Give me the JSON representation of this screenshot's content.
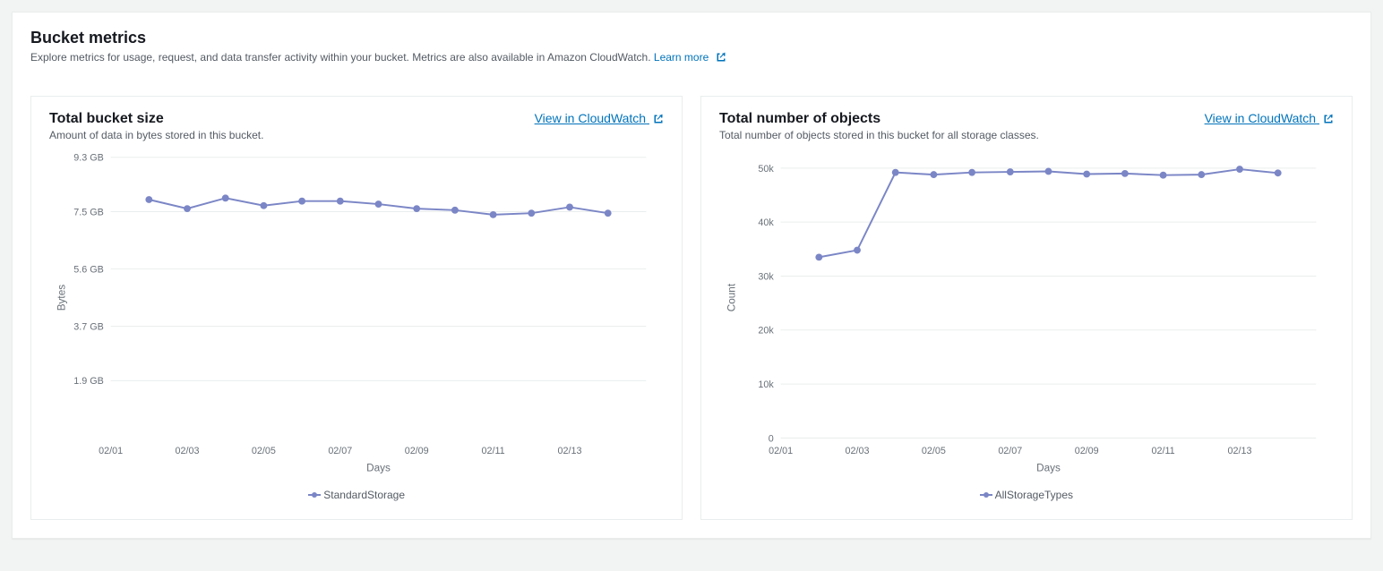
{
  "header": {
    "title": "Bucket metrics",
    "subtitle": "Explore metrics for usage, request, and data transfer activity within your bucket. Metrics are also available in Amazon CloudWatch.",
    "learn_more": "Learn more"
  },
  "cards": {
    "size": {
      "title": "Total bucket size",
      "subtitle": "Amount of data in bytes stored in this bucket.",
      "view_link": "View in CloudWatch"
    },
    "objects": {
      "title": "Total number of objects",
      "subtitle": "Total number of objects stored in this bucket for all storage classes.",
      "view_link": "View in CloudWatch"
    }
  },
  "chart_data": [
    {
      "id": "bucket_size",
      "type": "line",
      "title": "Total bucket size",
      "xlabel": "Days",
      "ylabel": "Bytes",
      "x": [
        "02/02",
        "02/03",
        "02/04",
        "02/05",
        "02/06",
        "02/07",
        "02/08",
        "02/09",
        "02/10",
        "02/11",
        "02/12",
        "02/13",
        "02/14"
      ],
      "x_ticks_shown": [
        "02/01",
        "02/03",
        "02/05",
        "02/07",
        "02/09",
        "02/11",
        "02/13"
      ],
      "y_ticks": [
        1.9,
        3.7,
        5.6,
        7.5,
        9.3
      ],
      "y_tick_labels": [
        "1.9 GB",
        "3.7 GB",
        "5.6 GB",
        "7.5 GB",
        "9.3 GB"
      ],
      "ylim": [
        0,
        9.3
      ],
      "series": [
        {
          "name": "StandardStorage",
          "values": [
            7.9,
            7.6,
            7.95,
            7.7,
            7.85,
            7.85,
            7.75,
            7.6,
            7.55,
            7.4,
            7.45,
            7.65,
            7.45
          ]
        }
      ]
    },
    {
      "id": "object_count",
      "type": "line",
      "title": "Total number of objects",
      "xlabel": "Days",
      "ylabel": "Count",
      "x": [
        "02/02",
        "02/03",
        "02/04",
        "02/05",
        "02/06",
        "02/07",
        "02/08",
        "02/09",
        "02/10",
        "02/11",
        "02/12",
        "02/13",
        "02/14"
      ],
      "x_ticks_shown": [
        "02/01",
        "02/03",
        "02/05",
        "02/07",
        "02/09",
        "02/11",
        "02/13"
      ],
      "y_ticks": [
        0,
        10000,
        20000,
        30000,
        40000,
        50000
      ],
      "y_tick_labels": [
        "0",
        "10k",
        "20k",
        "30k",
        "40k",
        "50k"
      ],
      "ylim": [
        0,
        52000
      ],
      "series": [
        {
          "name": "AllStorageTypes",
          "values": [
            33500,
            34800,
            49200,
            48800,
            49200,
            49300,
            49400,
            48900,
            49000,
            48700,
            48800,
            49800,
            49100
          ]
        }
      ]
    }
  ]
}
